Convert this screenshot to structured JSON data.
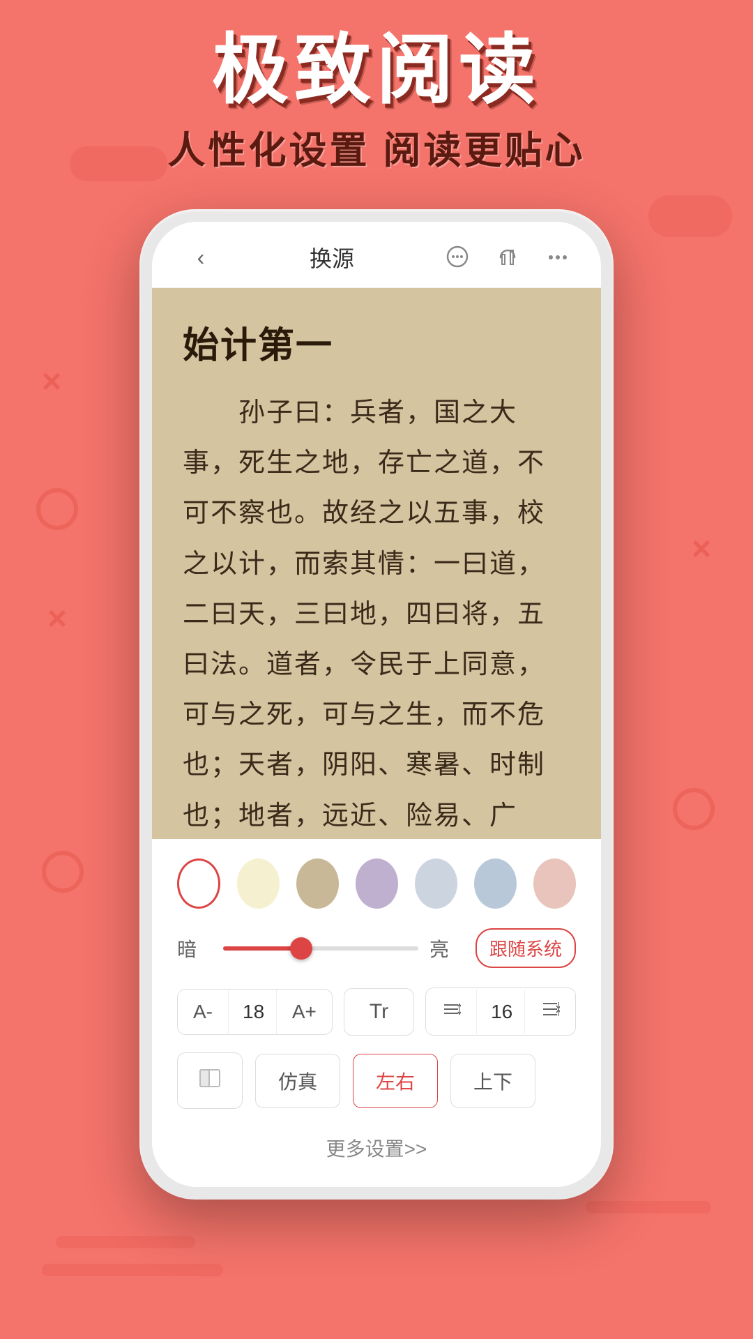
{
  "page": {
    "background_color": "#f4736a",
    "main_title": "极致阅读",
    "sub_title": "人性化设置  阅读更贴心"
  },
  "phone": {
    "topbar": {
      "back_label": "‹",
      "title": "换源",
      "chat_icon": "💬",
      "audio_icon": "🎧",
      "more_icon": "···"
    },
    "reading": {
      "chapter_title": "始计第一",
      "text": "　　孙子曰：兵者，国之大事，死生之地，存亡之道，不可不察也。故经之以五事，校之以计，而索其情：一曰道，二曰天，三曰地，四曰将，五曰法。道者，令民于上同意，可与之死，可与之生，而不危也；天者，阴阳、寒暑、时制也；地者，远近、险易、广狭、死生也；将者，智、"
    },
    "settings": {
      "brightness_dark_label": "暗",
      "brightness_light_label": "亮",
      "brightness_value": 40,
      "system_follow_label": "跟随系统",
      "font_size_label": "18",
      "font_decrease_label": "A-",
      "font_increase_label": "A+",
      "font_type_label": "Tr",
      "line_spacing_value": "16",
      "page_mode_simulate": "仿真",
      "page_mode_lr": "左右",
      "page_mode_ud": "上下",
      "more_settings_label": "更多设置>>"
    },
    "colors": [
      {
        "name": "white",
        "selected": true
      },
      {
        "name": "cream",
        "selected": false
      },
      {
        "name": "tan",
        "selected": false
      },
      {
        "name": "lavender",
        "selected": false
      },
      {
        "name": "lightgray",
        "selected": false
      },
      {
        "name": "lightblue",
        "selected": false
      },
      {
        "name": "pink",
        "selected": false
      }
    ]
  }
}
